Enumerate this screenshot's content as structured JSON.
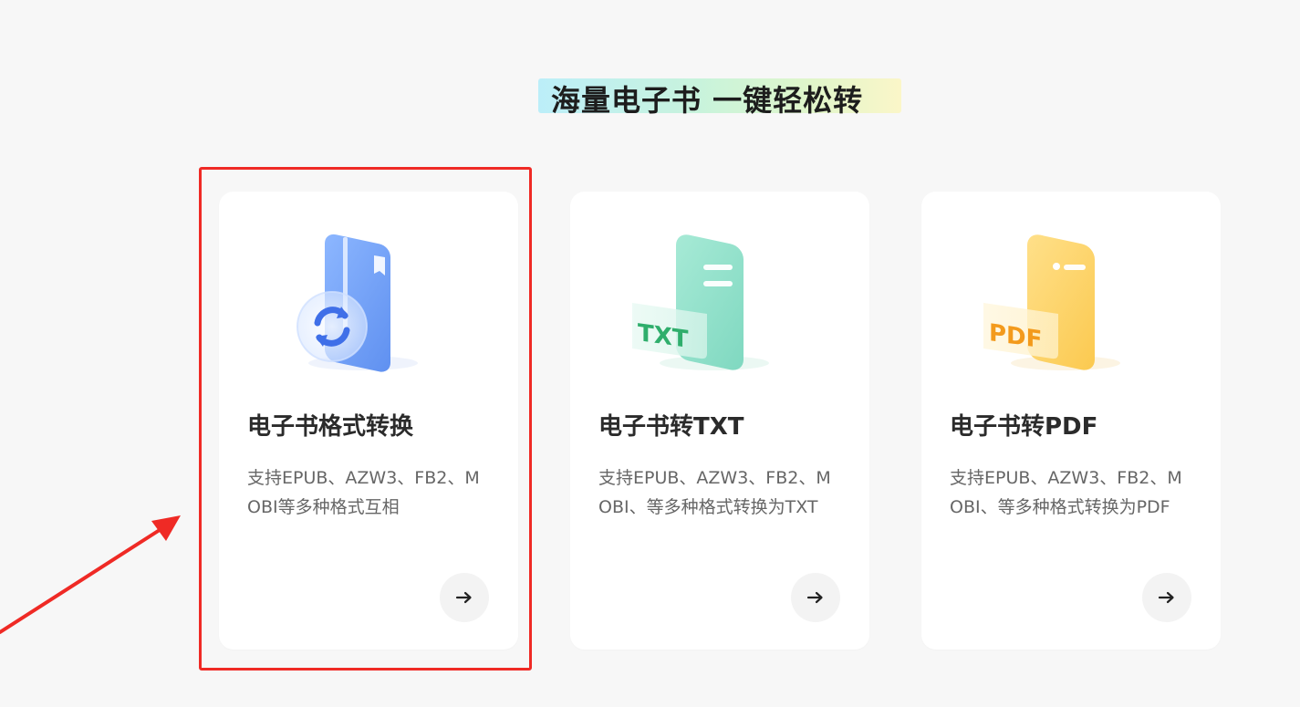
{
  "section": {
    "heading": "海量电子书  一键轻松转"
  },
  "cards": [
    {
      "title": "电子书格式转换",
      "description": "支持EPUB、AZW3、FB2、MOBI等多种格式互相",
      "icon": "ebook-convert-icon",
      "icon_color": "#6f9ff5",
      "arrow_icon": "arrow-right-icon"
    },
    {
      "title": "电子书转TXT",
      "description": "支持EPUB、AZW3、FB2、MOBI、等多种格式转换为TXT",
      "icon": "txt-file-icon",
      "icon_color": "#7fd8c0",
      "icon_label": "TXT",
      "arrow_icon": "arrow-right-icon"
    },
    {
      "title": "电子书转PDF",
      "description": "支持EPUB、AZW3、FB2、MOBI、等多种格式转换为PDF",
      "icon": "pdf-file-icon",
      "icon_color": "#fbc94f",
      "icon_label": "PDF",
      "arrow_icon": "arrow-right-icon"
    }
  ],
  "annotation": {
    "color": "#ef2a25"
  }
}
